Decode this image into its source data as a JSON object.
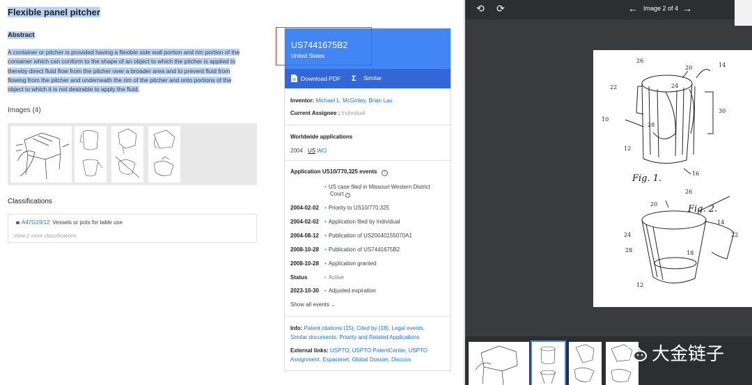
{
  "left": {
    "title": "Flexible panel pitcher",
    "abstract_heading": "Abstract",
    "abstract_lines": [
      "A container or pitcher is provided having a flexible side wall portion and rim portion of the",
      "container which can conform to the shape of an object to which the pitcher is applied to",
      "thereby direct fluid flow from the pitcher over a broader area and to prevent fluid from",
      "flowing from the pitcher and underneath the rim of the pitcher and onto portions of the",
      "object to which it is not desirable to apply the fluid."
    ],
    "images_heading": "Images (4)",
    "classifications_heading": "Classifications",
    "class_code": "A47G19/12",
    "class_desc": "Vessels or pots for table use",
    "class_more": "View 2 more classifications"
  },
  "card": {
    "patent_number": "US7441675B2",
    "country": "United States",
    "download_pdf": "Download PDF",
    "similar": "Similar",
    "inventor_label": "Inventor:",
    "inventors": "Michael L. McGinley, Brian Lau",
    "assignee_label": "Current Assignee :",
    "assignee": "Individual",
    "worldwide_heading": "Worldwide applications",
    "worldwide_year": "2004",
    "worldwide_sep": "·",
    "worldwide_us": "US",
    "worldwide_wo": "WO",
    "events_heading": "Application US10/770,325 events",
    "first_event_line1": "US case filed in Missouri Western District",
    "first_event_line2": "Court",
    "events": [
      {
        "date": "2004-02-02",
        "text": "Priority to US10/770,325"
      },
      {
        "date": "2004-02-02",
        "text": "Application filed by Individual"
      },
      {
        "date": "2004-08-12",
        "text": "Publication of US20040155070A1"
      },
      {
        "date": "2008-10-28",
        "text": "Publication of US7441675B2"
      },
      {
        "date": "2008-10-28",
        "text": "Application granted"
      },
      {
        "date": "Status",
        "text": "Active"
      },
      {
        "date": "2023-10-30",
        "text": "Adjusted expiration"
      }
    ],
    "show_all": "Show all events",
    "info_label": "Info:",
    "info_line1": "Patent citations (15), Cited by (18), Legal events,",
    "info_line2": "Similar documents, Priority and Related Applications",
    "external_label": "External links:",
    "external_line1": "USPTO, USPTO PatentCenter, USPTO",
    "external_line2": "Assignment, Espacenet, Global Dossier, Discuss"
  },
  "viewer": {
    "image_count": "Image 2 of 4",
    "fig1": "Fig. 1.",
    "fig2": "Fig. 2.",
    "refs_fig1": [
      "26",
      "20",
      "14",
      "22",
      "24",
      "30",
      "10",
      "28",
      "12",
      "16"
    ],
    "refs_fig2": [
      "26",
      "20",
      "14",
      "22",
      "24",
      "28",
      "18",
      "12"
    ]
  },
  "watermark": "大金链子",
  "colors": {
    "accent_blue": "#4285f4",
    "bar_blue": "#3367d6",
    "link_blue": "#1a73e8",
    "selection": "#b9d3f5",
    "highlight_red": "#e53935",
    "viewer_bg": "#3a3b3d"
  }
}
